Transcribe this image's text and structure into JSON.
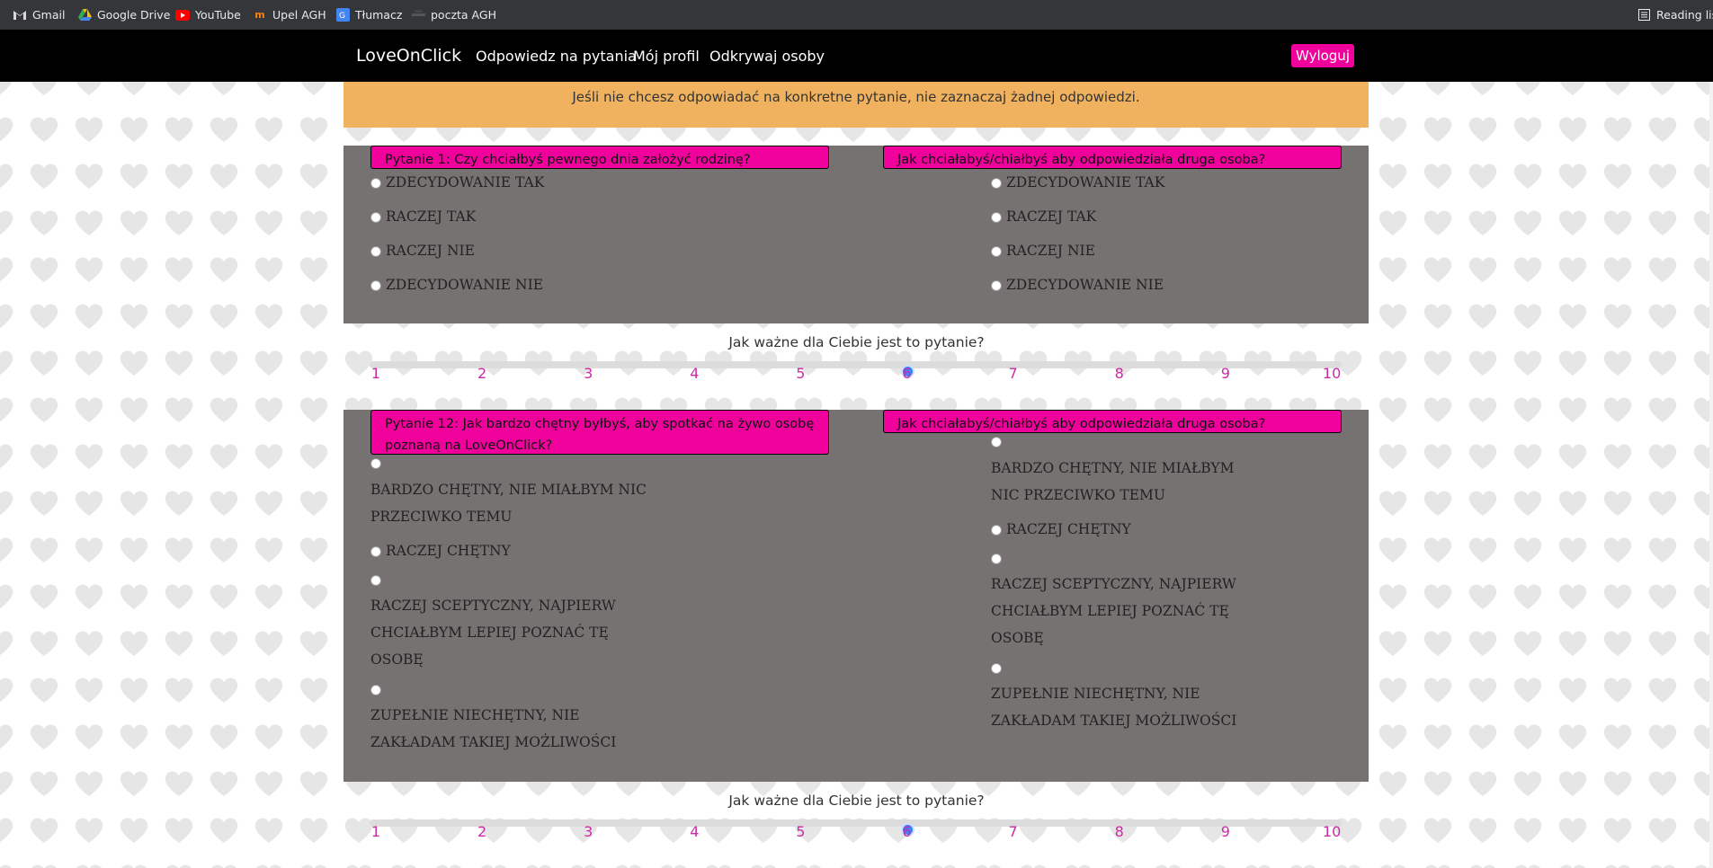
{
  "bookmarks": [
    {
      "label": "Gmail",
      "icon": "gmail-icon"
    },
    {
      "label": "Google Drive",
      "icon": "google-drive-icon"
    },
    {
      "label": "YouTube",
      "icon": "youtube-icon"
    },
    {
      "label": "Upel AGH",
      "icon": "moodle-icon"
    },
    {
      "label": "Tłumacz",
      "icon": "translate-icon"
    },
    {
      "label": "poczta AGH",
      "icon": "mail-icon"
    }
  ],
  "reading_list": {
    "label": "Reading list",
    "icon": "reading-list-icon"
  },
  "nav": {
    "brand": "LoveOnClick",
    "links": [
      "Odpowiedz na pytania",
      "Mój profil",
      "Odkrywaj osoby"
    ],
    "logout": "Wyloguj"
  },
  "info_text": "Jeśli nie chcesz odpowiadać na konkretne pytanie, nie zaznaczaj żadnej odpowiedzi.",
  "questions": [
    {
      "title": "Pytanie 1: Czy chciałbyś pewnego dnia założyć rodzinę?",
      "partner_title": "Jak chciałabyś/chiałbyś aby odpowiedziała druga osoba?",
      "options": [
        "ZDECYDOWANIE TAK",
        "RACZEJ TAK",
        "RACZEJ NIE",
        "ZDECYDOWANIE NIE"
      ],
      "importance_label": "Jak ważne dla Ciebie jest to pytanie?",
      "importance": 6
    },
    {
      "title": "Pytanie 12: Jak bardzo chętny byłbyś, aby spotkać na żywo osobę poznaną na LoveOnClick?",
      "partner_title": "Jak chciałabyś/chiałbyś aby odpowiedziała druga osoba?",
      "options": [
        "BARDZO CHĘTNY, NIE MIAŁBYM NIC PRZECIWKO TEMU",
        "RACZEJ CHĘTNY",
        "RACZEJ SCEPTYCZNY, NAJPIERW CHCIAŁBYM LEPIEJ POZNAĆ TĘ OSOBĘ",
        "ZUPEŁNIE NIECHĘTNY, NIE ZAKŁADAM TAKIEJ MOŻLIWOŚCI"
      ],
      "importance_label": "Jak ważne dla Ciebie jest to pytanie?",
      "importance": 6
    }
  ],
  "scale": [
    "1",
    "2",
    "3",
    "4",
    "5",
    "6",
    "7",
    "8",
    "9",
    "10"
  ]
}
